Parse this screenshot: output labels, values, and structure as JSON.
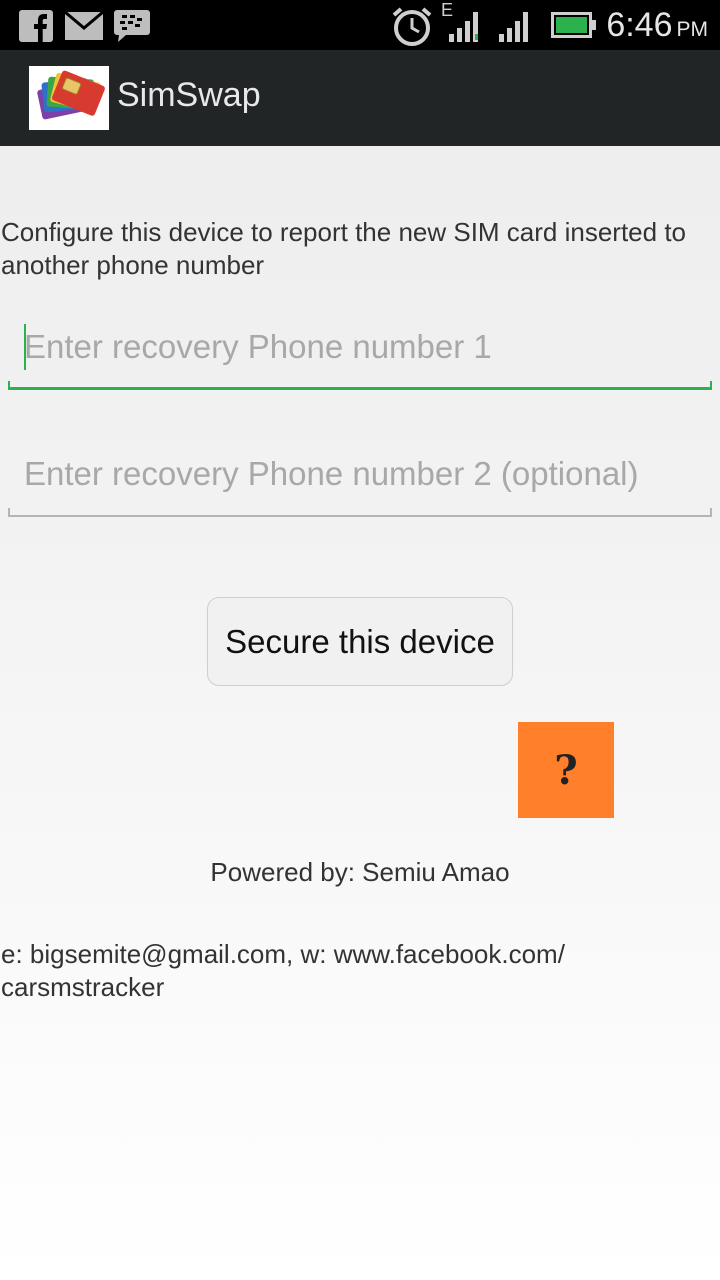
{
  "status_bar": {
    "time": "6:46",
    "ampm": "PM",
    "network_type": "E",
    "icons": [
      "facebook-icon",
      "mail-icon",
      "bbm-icon",
      "alarm-icon",
      "signal-icon",
      "signal-icon",
      "battery-icon"
    ]
  },
  "action_bar": {
    "title": "SimSwap",
    "icon": "sim-cards-icon"
  },
  "main": {
    "description": "Configure this device to report the new SIM card inserted to another phone number",
    "phone1": {
      "placeholder": "Enter recovery Phone number 1",
      "value": ""
    },
    "phone2": {
      "placeholder": "Enter recovery Phone number 2 (optional)",
      "value": ""
    },
    "secure_button": "Secure this device",
    "help_button": "?",
    "powered_by": "Powered by: Semiu Amao",
    "contact": "e: bigsemite@gmail.com, w: www.facebook.com/\ncarsmstracker"
  },
  "colors": {
    "focus_underline": "#2bb24c",
    "help_button_bg": "#ff7f2a",
    "action_bar_bg": "#222526"
  }
}
